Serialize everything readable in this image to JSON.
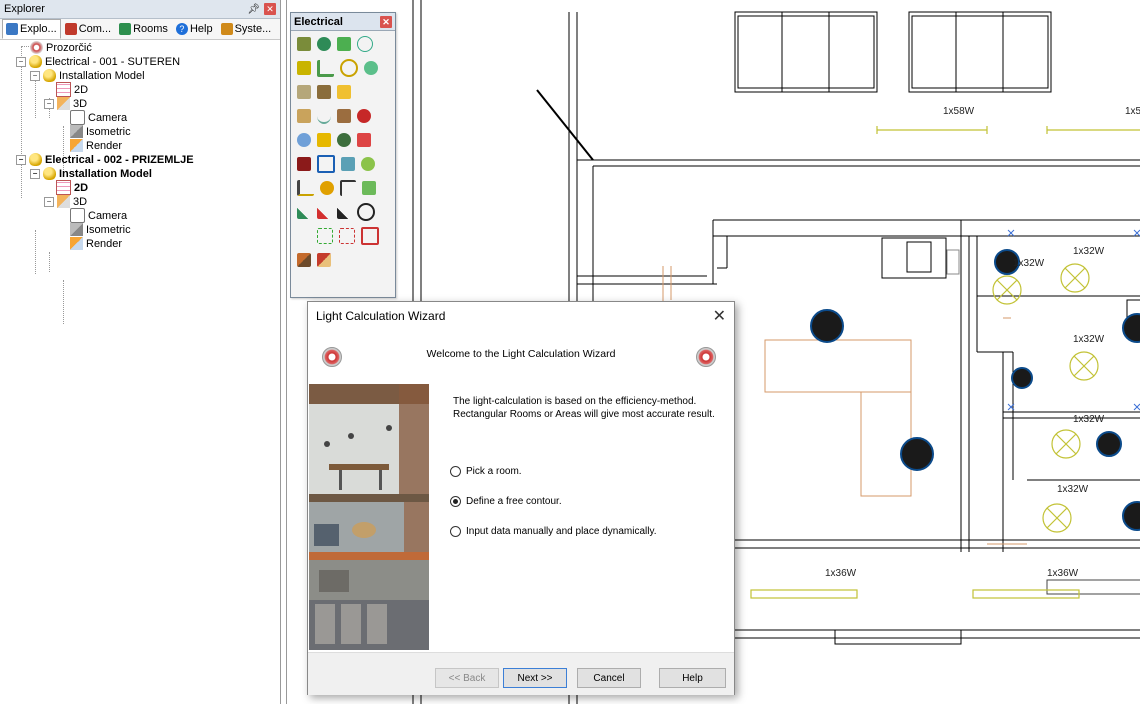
{
  "explorer": {
    "title": "Explorer",
    "tabs": [
      {
        "label": "Explo...",
        "icon": "explorer-tree-icon"
      },
      {
        "label": "Com...",
        "icon": "components-icon"
      },
      {
        "label": "Rooms",
        "icon": "rooms-icon"
      },
      {
        "label": "Help",
        "icon": "help-icon"
      },
      {
        "label": "Syste...",
        "icon": "system-icon"
      }
    ],
    "tree": [
      {
        "label": "Prozorčić"
      },
      {
        "label": "Electrical - 001 - SUTEREN"
      },
      {
        "label": "Installation Model"
      },
      {
        "label": "2D"
      },
      {
        "label": "3D"
      },
      {
        "label": "Camera"
      },
      {
        "label": "Isometric"
      },
      {
        "label": "Render"
      },
      {
        "label": "Electrical - 002 - PRIZEMLJE"
      },
      {
        "label": "Installation Model"
      },
      {
        "label": "2D"
      },
      {
        "label": "3D"
      },
      {
        "label": "Camera"
      },
      {
        "label": "Isometric"
      },
      {
        "label": "Render"
      }
    ]
  },
  "palette": {
    "title": "Electrical"
  },
  "drawing": {
    "labels": [
      "1x58W",
      "1x5",
      "1x32W",
      "1x32W",
      "1x32W",
      "1x32W",
      "1x32W",
      "1x36W",
      "1x36W"
    ]
  },
  "dialog": {
    "title": "Light Calculation Wizard",
    "welcome": "Welcome to the Light Calculation Wizard",
    "description": "The light-calculation is based on the efficiency-method. Rectangular Rooms or Areas will give most accurate result.",
    "options": [
      {
        "label": "Pick a room.",
        "selected": false
      },
      {
        "label": "Define a free contour.",
        "selected": true
      },
      {
        "label": "Input data manually and place dynamically.",
        "selected": false
      }
    ],
    "buttons": {
      "back": "<< Back",
      "next": "Next >>",
      "cancel": "Cancel",
      "help": "Help"
    }
  }
}
